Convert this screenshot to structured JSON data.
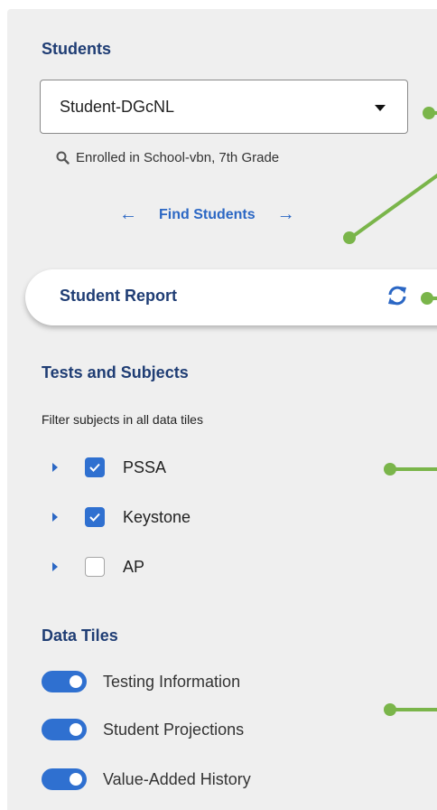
{
  "students": {
    "title": "Students",
    "selected": "Student-DGcNL",
    "enrolled": "Enrolled in School-vbn, 7th Grade",
    "find_label": "Find Students"
  },
  "report": {
    "label": "Student Report"
  },
  "tests": {
    "title": "Tests and Subjects",
    "filter_label": "Filter subjects in all data tiles",
    "items": [
      {
        "label": "PSSA",
        "checked": true
      },
      {
        "label": "Keystone",
        "checked": true
      },
      {
        "label": "AP",
        "checked": false
      }
    ]
  },
  "tiles": {
    "title": "Data Tiles",
    "items": [
      {
        "label": "Testing Information",
        "enabled": true
      },
      {
        "label": "Student Projections",
        "enabled": true
      },
      {
        "label": "Value-Added History",
        "enabled": true
      }
    ]
  },
  "colors": {
    "heading": "#1f3d74",
    "accent_blue": "#2f70d0",
    "callout_green": "#7ab54a",
    "panel_bg": "#efefef"
  }
}
